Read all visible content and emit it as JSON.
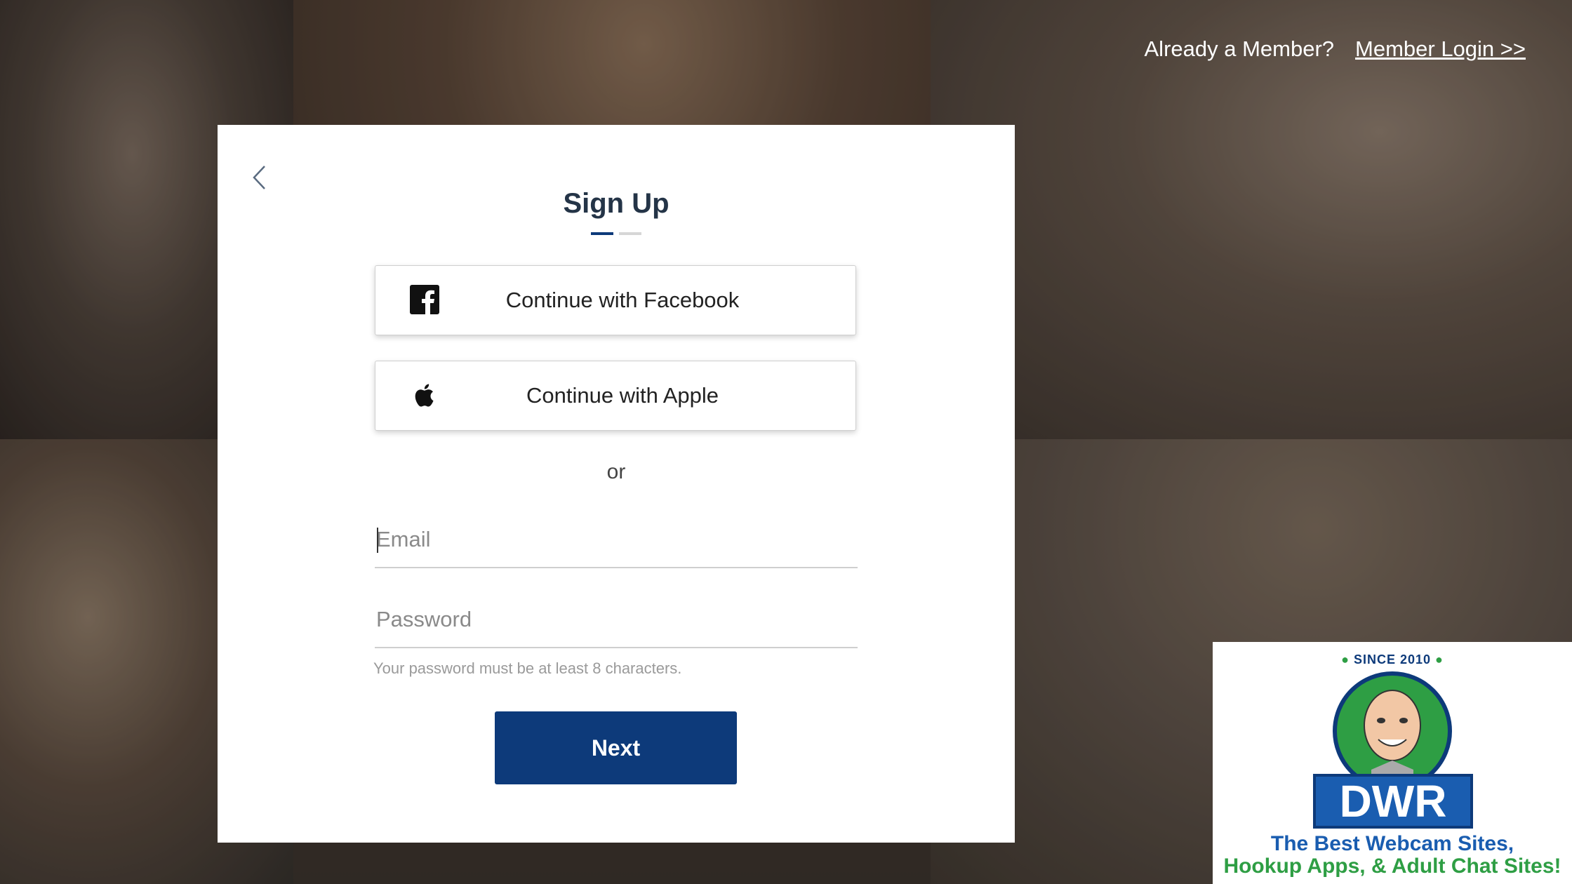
{
  "header": {
    "member_prompt": "Already a Member?",
    "login_link": "Member Login >>"
  },
  "signup": {
    "title": "Sign Up",
    "facebook_label": "Continue with Facebook",
    "apple_label": "Continue with Apple",
    "or_text": "or",
    "email_placeholder": "Email",
    "password_placeholder": "Password",
    "password_hint": "Your password must be at least 8 characters.",
    "next_label": "Next",
    "steps": 2,
    "active_step": 1
  },
  "badge": {
    "since": "SINCE 2010",
    "logo": "DWR",
    "tagline_line1": "The Best Webcam Sites,",
    "tagline_line2": "Hookup Apps, & Adult Chat Sites!"
  },
  "colors": {
    "primary": "#0d3a7a",
    "badge_blue": "#1a5db0",
    "badge_green": "#2e9e44"
  },
  "icons": [
    "chevron-left-icon",
    "facebook-icon",
    "apple-icon"
  ]
}
